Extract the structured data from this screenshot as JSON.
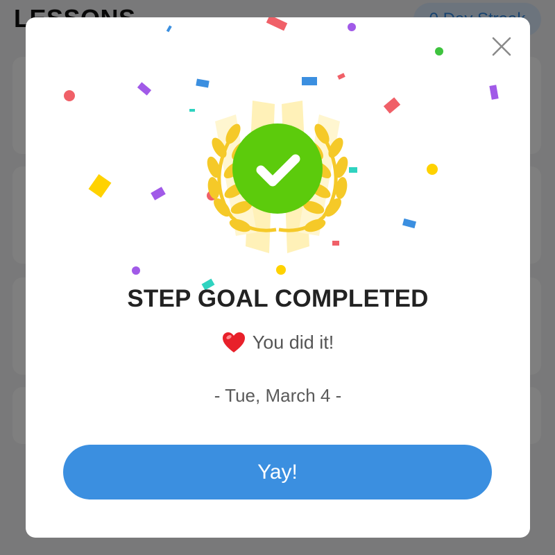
{
  "background": {
    "title": "LESSONS",
    "streak_badge": "0 Day Streak"
  },
  "modal": {
    "title": "STEP GOAL COMPLETED",
    "subtitle": "You did it!",
    "date": "- Tue, March 4 -",
    "button_label": "Yay!",
    "close_icon": "close-icon",
    "heart_icon": "heart-icon",
    "badge_icon": "laurel-check-badge-icon"
  },
  "colors": {
    "success_green": "#5ccb0c",
    "laurel_gold": "#f5c928",
    "button_blue": "#3b8fe0",
    "overlay": "rgba(0,0,0,0.5)"
  }
}
